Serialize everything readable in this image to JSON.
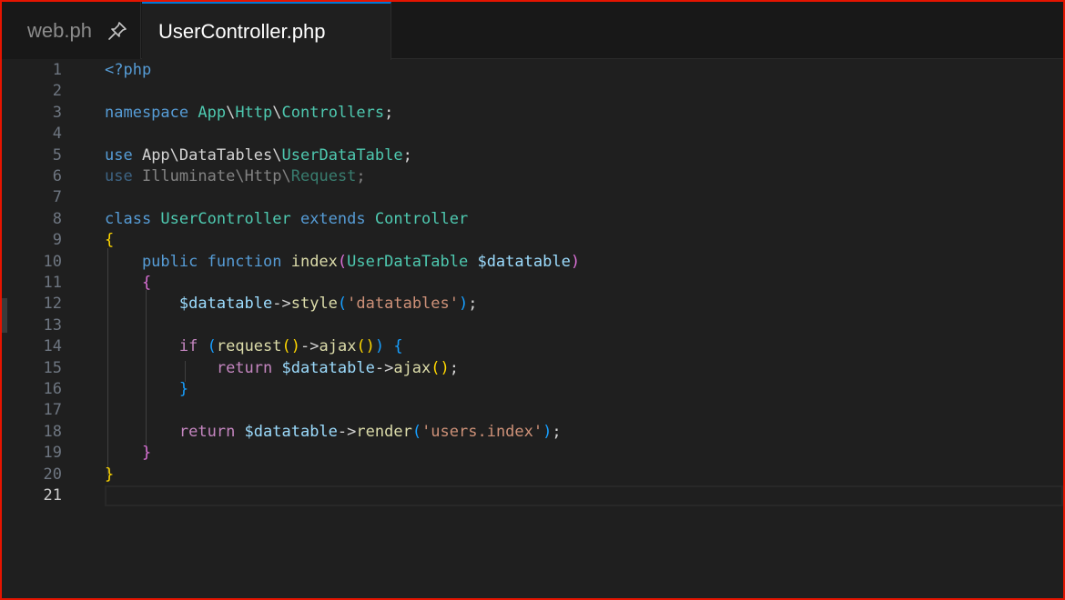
{
  "tabs": [
    {
      "label": "web.ph",
      "active": false,
      "pinned": true
    },
    {
      "label": "UserController.php",
      "active": true
    }
  ],
  "current_line": "21",
  "lines": [
    {
      "n": "1",
      "tokens": [
        {
          "t": "<?php",
          "c": "kw"
        }
      ]
    },
    {
      "n": "2",
      "tokens": []
    },
    {
      "n": "3",
      "tokens": [
        {
          "t": "namespace ",
          "c": "kw"
        },
        {
          "t": "App",
          "c": "ty"
        },
        {
          "t": "\\",
          "c": "pl"
        },
        {
          "t": "Http",
          "c": "ty"
        },
        {
          "t": "\\",
          "c": "pl"
        },
        {
          "t": "Controllers",
          "c": "ty"
        },
        {
          "t": ";",
          "c": "pl"
        }
      ]
    },
    {
      "n": "4",
      "tokens": []
    },
    {
      "n": "5",
      "tokens": [
        {
          "t": "use ",
          "c": "kw"
        },
        {
          "t": "App",
          "c": "pl"
        },
        {
          "t": "\\",
          "c": "pl"
        },
        {
          "t": "DataTables",
          "c": "pl"
        },
        {
          "t": "\\",
          "c": "pl"
        },
        {
          "t": "UserDataTable",
          "c": "ty"
        },
        {
          "t": ";",
          "c": "pl"
        }
      ]
    },
    {
      "n": "6",
      "tokens": [
        {
          "t": "use ",
          "c": "kw dim"
        },
        {
          "t": "Illuminate",
          "c": "pl dim"
        },
        {
          "t": "\\",
          "c": "pl dim"
        },
        {
          "t": "Http",
          "c": "pl dim"
        },
        {
          "t": "\\",
          "c": "pl dim"
        },
        {
          "t": "Request",
          "c": "ty dim"
        },
        {
          "t": ";",
          "c": "pl dim"
        }
      ]
    },
    {
      "n": "7",
      "tokens": []
    },
    {
      "n": "8",
      "tokens": [
        {
          "t": "class ",
          "c": "kw"
        },
        {
          "t": "UserController ",
          "c": "ty"
        },
        {
          "t": "extends ",
          "c": "kw"
        },
        {
          "t": "Controller",
          "c": "ty"
        }
      ]
    },
    {
      "n": "9",
      "tokens": [
        {
          "t": "{",
          "c": "b1"
        }
      ]
    },
    {
      "n": "10",
      "tokens": [
        {
          "t": "    public ",
          "c": "kw"
        },
        {
          "t": "function ",
          "c": "kw"
        },
        {
          "t": "index",
          "c": "fn"
        },
        {
          "t": "(",
          "c": "b2"
        },
        {
          "t": "UserDataTable ",
          "c": "ty"
        },
        {
          "t": "$datatable",
          "c": "var"
        },
        {
          "t": ")",
          "c": "b2"
        }
      ]
    },
    {
      "n": "11",
      "tokens": [
        {
          "t": "    ",
          "c": "pl"
        },
        {
          "t": "{",
          "c": "b2"
        }
      ]
    },
    {
      "n": "12",
      "tokens": [
        {
          "t": "        ",
          "c": "pl"
        },
        {
          "t": "$datatable",
          "c": "var"
        },
        {
          "t": "->",
          "c": "pl"
        },
        {
          "t": "style",
          "c": "fn"
        },
        {
          "t": "(",
          "c": "b3"
        },
        {
          "t": "'datatables'",
          "c": "str"
        },
        {
          "t": ")",
          "c": "b3"
        },
        {
          "t": ";",
          "c": "pl"
        }
      ]
    },
    {
      "n": "13",
      "tokens": []
    },
    {
      "n": "14",
      "tokens": [
        {
          "t": "        ",
          "c": "pl"
        },
        {
          "t": "if ",
          "c": "ctl"
        },
        {
          "t": "(",
          "c": "b3"
        },
        {
          "t": "request",
          "c": "fn"
        },
        {
          "t": "()",
          "c": "b1"
        },
        {
          "t": "->",
          "c": "pl"
        },
        {
          "t": "ajax",
          "c": "fn"
        },
        {
          "t": "()",
          "c": "b1"
        },
        {
          "t": ")",
          "c": "b3"
        },
        {
          "t": " ",
          "c": "pl"
        },
        {
          "t": "{",
          "c": "b3"
        }
      ]
    },
    {
      "n": "15",
      "tokens": [
        {
          "t": "            ",
          "c": "pl"
        },
        {
          "t": "return ",
          "c": "ctl"
        },
        {
          "t": "$datatable",
          "c": "var"
        },
        {
          "t": "->",
          "c": "pl"
        },
        {
          "t": "ajax",
          "c": "fn"
        },
        {
          "t": "()",
          "c": "b1"
        },
        {
          "t": ";",
          "c": "pl"
        }
      ]
    },
    {
      "n": "16",
      "tokens": [
        {
          "t": "        ",
          "c": "pl"
        },
        {
          "t": "}",
          "c": "b3"
        }
      ]
    },
    {
      "n": "17",
      "tokens": []
    },
    {
      "n": "18",
      "tokens": [
        {
          "t": "        ",
          "c": "pl"
        },
        {
          "t": "return ",
          "c": "ctl"
        },
        {
          "t": "$datatable",
          "c": "var"
        },
        {
          "t": "->",
          "c": "pl"
        },
        {
          "t": "render",
          "c": "fn"
        },
        {
          "t": "(",
          "c": "b3"
        },
        {
          "t": "'users.index'",
          "c": "str"
        },
        {
          "t": ")",
          "c": "b3"
        },
        {
          "t": ";",
          "c": "pl"
        }
      ]
    },
    {
      "n": "19",
      "tokens": [
        {
          "t": "    ",
          "c": "pl"
        },
        {
          "t": "}",
          "c": "b2"
        }
      ]
    },
    {
      "n": "20",
      "tokens": [
        {
          "t": "}",
          "c": "b1"
        }
      ]
    },
    {
      "n": "21",
      "tokens": []
    }
  ]
}
